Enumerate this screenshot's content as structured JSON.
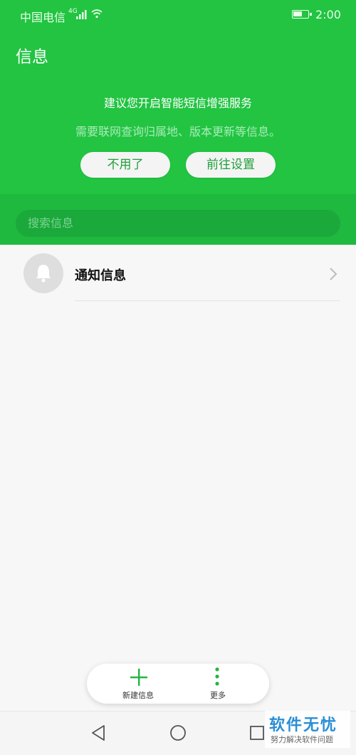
{
  "status": {
    "carrier": "中国电信",
    "signal_type": "4G",
    "time": "2:00",
    "battery_percent": 55
  },
  "header": {
    "title": "信息"
  },
  "banner": {
    "title": "建议您开启智能短信增强服务",
    "subtitle": "需要联网查询归属地、版本更新等信息。",
    "decline_label": "不用了",
    "settings_label": "前往设置"
  },
  "search": {
    "placeholder": "搜索信息"
  },
  "conversations": [
    {
      "title": "通知信息",
      "icon": "bell-icon"
    }
  ],
  "fab": {
    "new_label": "新建信息",
    "more_label": "更多"
  },
  "watermark": {
    "title": "软件无忧",
    "subtitle": "努力解决软件问题"
  },
  "colors": {
    "accent": "#22c442",
    "button_text": "#1fa03a"
  }
}
